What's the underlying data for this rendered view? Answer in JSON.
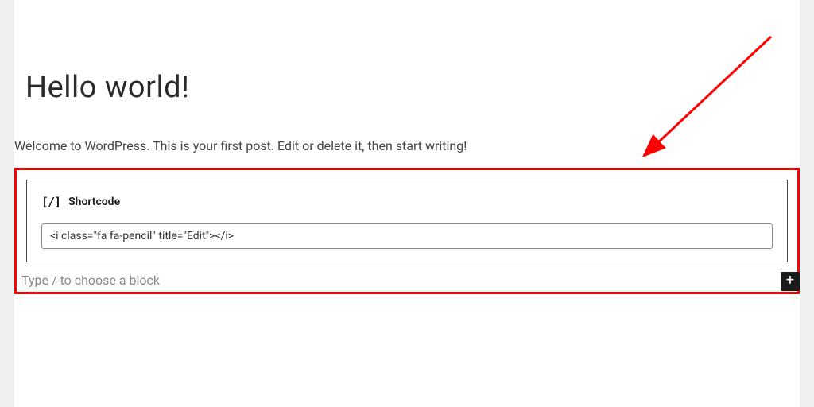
{
  "post": {
    "title": "Hello world!",
    "paragraph": "Welcome to WordPress. This is your first post. Edit or delete it, then start writing!"
  },
  "shortcode_block": {
    "icon_text": "[/]",
    "label": "Shortcode",
    "input_value": "<i class=\"fa fa-pencil\" title=\"Edit\"></i>"
  },
  "appender": {
    "placeholder": "Type / to choose a block",
    "add_button_glyph": "+"
  },
  "colors": {
    "highlight": "#ff0000",
    "arrow": "#ff0000"
  }
}
